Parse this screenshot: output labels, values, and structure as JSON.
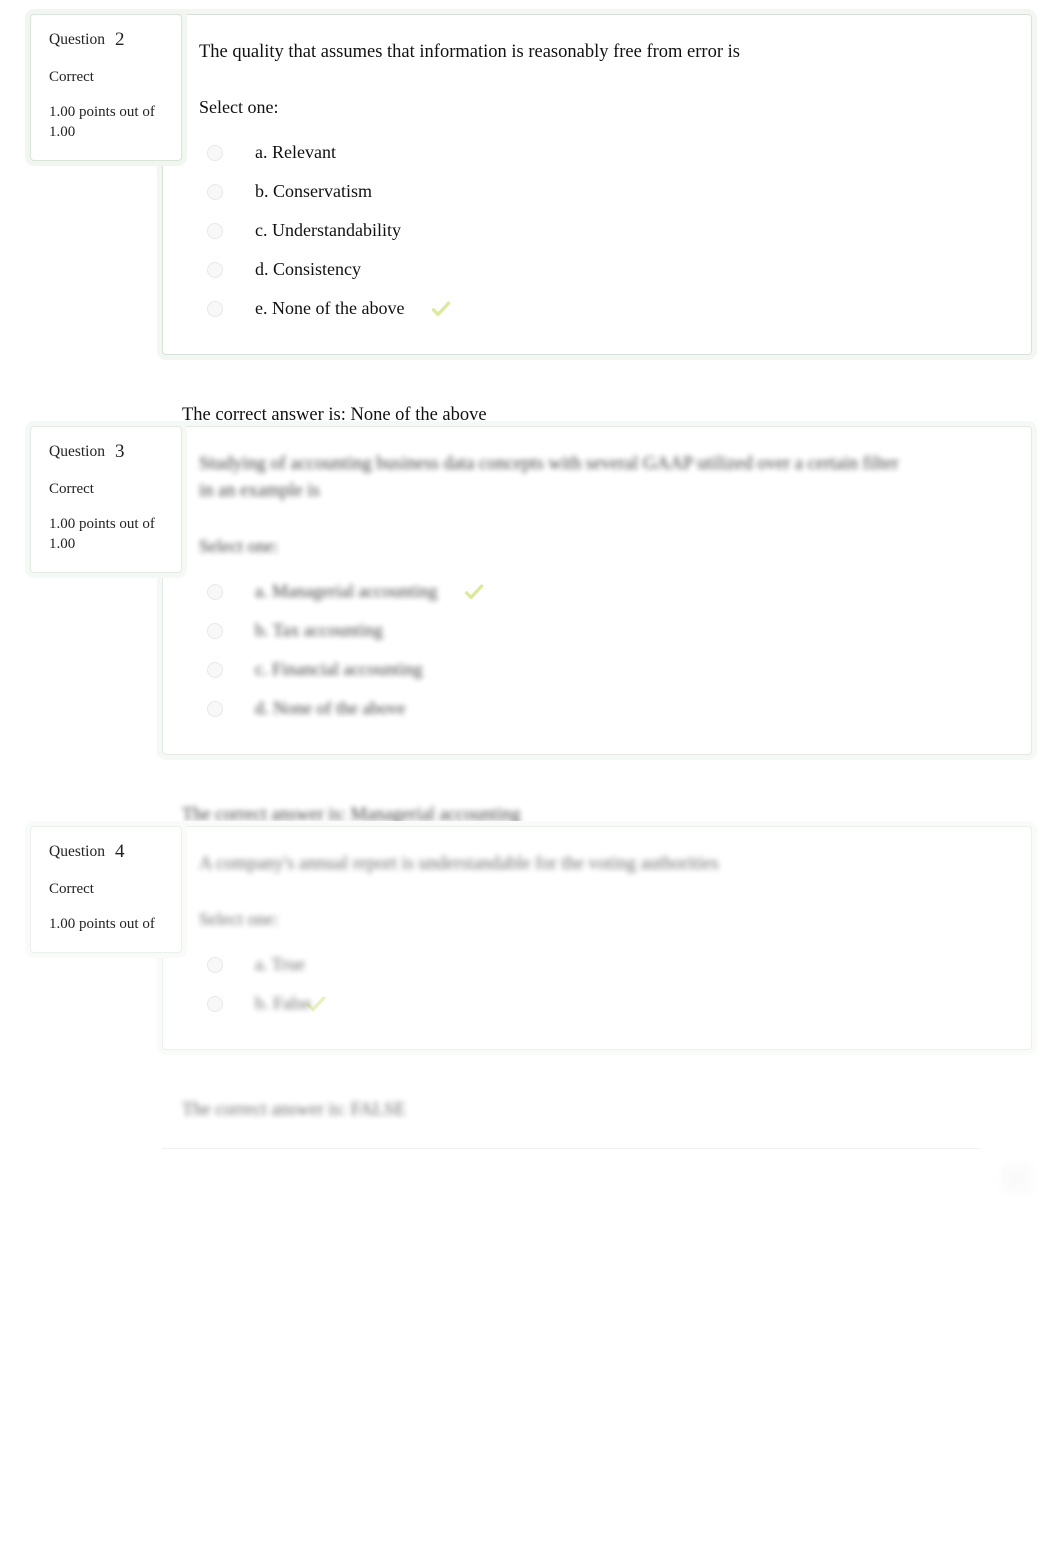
{
  "page": {
    "kind": "quiz-review",
    "accent_border": "#d7e3d7",
    "accent_glow": "#f1f6f1",
    "tick_color": "#b7cf2e"
  },
  "questions": [
    {
      "id": "q2",
      "label": "Question",
      "number": "2",
      "state": "Correct",
      "grade": "1.00 points out of 1.00",
      "grade_clipped": false,
      "blurred": false,
      "text": "The quality that assumes that information is reasonably free from error is",
      "select_prompt": "Select one:",
      "options": [
        {
          "label": "a. Relevant",
          "checked": false
        },
        {
          "label": "b. Conservatism",
          "checked": false
        },
        {
          "label": "c. Understandability",
          "checked": false
        },
        {
          "label": "d. Consistency",
          "checked": false
        },
        {
          "label": "e. None of the above",
          "checked": true
        }
      ],
      "feedback": "The correct answer is: None of the above"
    },
    {
      "id": "q3",
      "label": "Question",
      "number": "3",
      "state": "Correct",
      "grade": "1.00 points out of 1.00",
      "grade_clipped": false,
      "blurred": true,
      "text": "Studying of accounting business data concepts with several GAAP utilized over a certain filter in an example is",
      "select_prompt": "Select one:",
      "options": [
        {
          "label": "a. Managerial accounting",
          "checked": true
        },
        {
          "label": "b. Tax accounting",
          "checked": false
        },
        {
          "label": "c. Financial accounting",
          "checked": false
        },
        {
          "label": "d. None of the above",
          "checked": false
        }
      ],
      "feedback": "The correct answer is: Managerial accounting"
    },
    {
      "id": "q4",
      "label": "Question",
      "number": "4",
      "state": "Correct",
      "grade": "1.00 points out of",
      "grade_clipped": true,
      "blurred": true,
      "text": "A company's annual report is understandable for the voting authorities",
      "select_prompt": "Select one:",
      "options": [
        {
          "label": "a. True",
          "checked": false
        },
        {
          "label": "b. False",
          "checked": true
        }
      ],
      "feedback": "The correct answer is: FALSE"
    }
  ]
}
